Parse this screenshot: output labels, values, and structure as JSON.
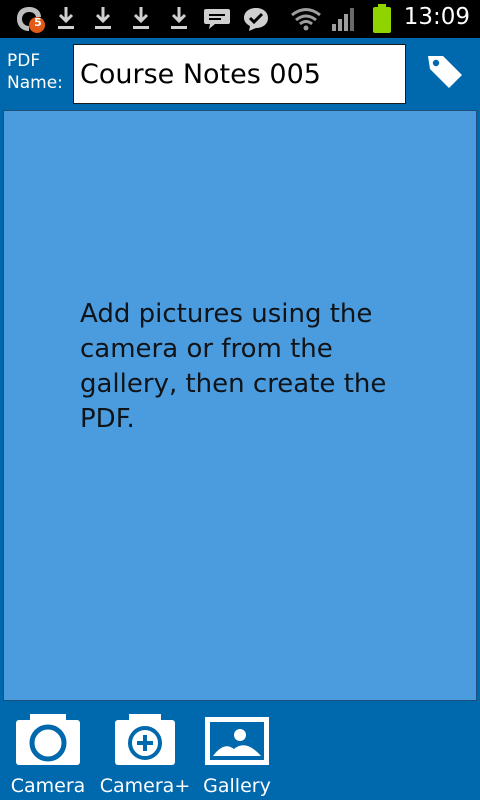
{
  "status_bar": {
    "time": "13:09",
    "notification_badge": "5",
    "icons": [
      "app-notification-icon",
      "download-icon",
      "download-icon",
      "download-icon",
      "download-icon",
      "message-icon",
      "chat-check-icon",
      "wifi-icon",
      "signal-icon",
      "battery-icon"
    ]
  },
  "header": {
    "pdf_name_label": "PDF\nName:",
    "pdf_name_value": "Course Notes 005"
  },
  "main": {
    "hint": "Add pictures using the camera or from the gallery, then create the PDF."
  },
  "toolbar": {
    "camera_label": "Camera",
    "camera_plus_label": "Camera+",
    "gallery_label": "Gallery"
  },
  "colors": {
    "background": "#0068ac",
    "panel": "#4a9cdf",
    "status_bar": "#000000",
    "battery": "#8fd400",
    "badge": "#e25a17"
  }
}
